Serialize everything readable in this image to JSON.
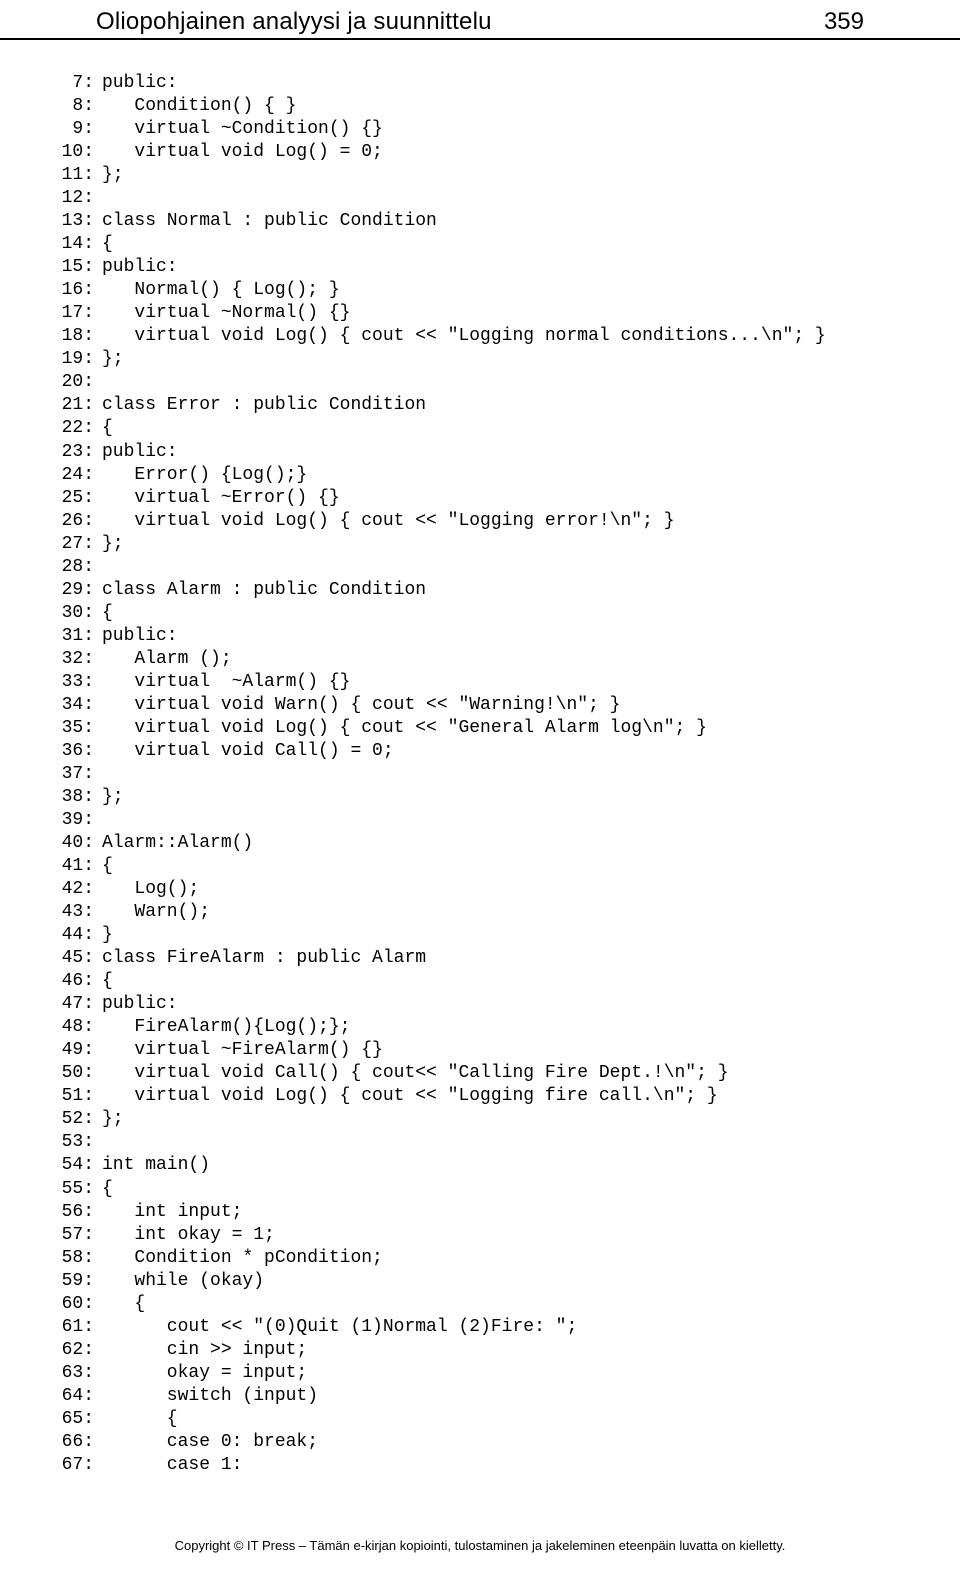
{
  "header": {
    "title": "Oliopohjainen analyysi ja suunnittelu",
    "page_number": "359"
  },
  "code_lines": [
    {
      "n": "7:",
      "t": "public:"
    },
    {
      "n": "8:",
      "t": "   Condition() { }"
    },
    {
      "n": "9:",
      "t": "   virtual ~Condition() {}"
    },
    {
      "n": "10:",
      "t": "   virtual void Log() = 0;"
    },
    {
      "n": "11:",
      "t": "};"
    },
    {
      "n": "12:",
      "t": ""
    },
    {
      "n": "13:",
      "t": "class Normal : public Condition"
    },
    {
      "n": "14:",
      "t": "{"
    },
    {
      "n": "15:",
      "t": "public:"
    },
    {
      "n": "16:",
      "t": "   Normal() { Log(); }"
    },
    {
      "n": "17:",
      "t": "   virtual ~Normal() {}"
    },
    {
      "n": "18:",
      "t": "   virtual void Log() { cout << \"Logging normal conditions...\\n\"; }"
    },
    {
      "n": "19:",
      "t": "};"
    },
    {
      "n": "20:",
      "t": ""
    },
    {
      "n": "21:",
      "t": "class Error : public Condition"
    },
    {
      "n": "22:",
      "t": "{"
    },
    {
      "n": "23:",
      "t": "public:"
    },
    {
      "n": "24:",
      "t": "   Error() {Log();}"
    },
    {
      "n": "25:",
      "t": "   virtual ~Error() {}"
    },
    {
      "n": "26:",
      "t": "   virtual void Log() { cout << \"Logging error!\\n\"; }"
    },
    {
      "n": "27:",
      "t": "};"
    },
    {
      "n": "28:",
      "t": ""
    },
    {
      "n": "29:",
      "t": "class Alarm : public Condition"
    },
    {
      "n": "30:",
      "t": "{"
    },
    {
      "n": "31:",
      "t": "public:"
    },
    {
      "n": "32:",
      "t": "   Alarm ();"
    },
    {
      "n": "33:",
      "t": "   virtual  ~Alarm() {}"
    },
    {
      "n": "34:",
      "t": "   virtual void Warn() { cout << \"Warning!\\n\"; }"
    },
    {
      "n": "35:",
      "t": "   virtual void Log() { cout << \"General Alarm log\\n\"; }"
    },
    {
      "n": "36:",
      "t": "   virtual void Call() = 0;"
    },
    {
      "n": "37:",
      "t": ""
    },
    {
      "n": "38:",
      "t": "};"
    },
    {
      "n": "39:",
      "t": ""
    },
    {
      "n": "40:",
      "t": "Alarm::Alarm()"
    },
    {
      "n": "41:",
      "t": "{"
    },
    {
      "n": "42:",
      "t": "   Log();"
    },
    {
      "n": "43:",
      "t": "   Warn();"
    },
    {
      "n": "44:",
      "t": "}"
    },
    {
      "n": "45:",
      "t": "class FireAlarm : public Alarm"
    },
    {
      "n": "46:",
      "t": "{"
    },
    {
      "n": "47:",
      "t": "public:"
    },
    {
      "n": "48:",
      "t": "   FireAlarm(){Log();};"
    },
    {
      "n": "49:",
      "t": "   virtual ~FireAlarm() {}"
    },
    {
      "n": "50:",
      "t": "   virtual void Call() { cout<< \"Calling Fire Dept.!\\n\"; }"
    },
    {
      "n": "51:",
      "t": "   virtual void Log() { cout << \"Logging fire call.\\n\"; }"
    },
    {
      "n": "52:",
      "t": "};"
    },
    {
      "n": "53:",
      "t": ""
    },
    {
      "n": "54:",
      "t": "int main()"
    },
    {
      "n": "55:",
      "t": "{"
    },
    {
      "n": "56:",
      "t": "   int input;"
    },
    {
      "n": "57:",
      "t": "   int okay = 1;"
    },
    {
      "n": "58:",
      "t": "   Condition * pCondition;"
    },
    {
      "n": "59:",
      "t": "   while (okay)"
    },
    {
      "n": "60:",
      "t": "   {"
    },
    {
      "n": "61:",
      "t": "      cout << \"(0)Quit (1)Normal (2)Fire: \";"
    },
    {
      "n": "62:",
      "t": "      cin >> input;"
    },
    {
      "n": "63:",
      "t": "      okay = input;"
    },
    {
      "n": "64:",
      "t": "      switch (input)"
    },
    {
      "n": "65:",
      "t": "      {"
    },
    {
      "n": "66:",
      "t": "      case 0: break;"
    },
    {
      "n": "67:",
      "t": "      case 1:"
    }
  ],
  "footer": "Copyright © IT Press – Tämän e-kirjan kopiointi, tulostaminen ja jakeleminen eteenpäin luvatta on kielletty."
}
